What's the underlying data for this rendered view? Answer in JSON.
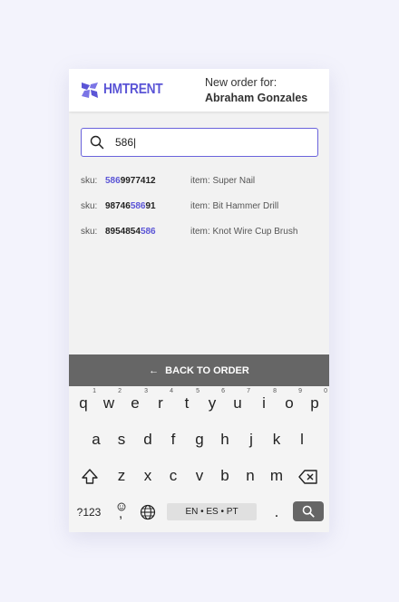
{
  "header": {
    "brand": "HMTRENT",
    "order_label": "New order for:",
    "customer_name": "Abraham Gonzales"
  },
  "search": {
    "value": "586|"
  },
  "results": [
    {
      "sku_label": "sku:",
      "sku_pre": "",
      "sku_match": "586",
      "sku_post": "9977412",
      "item": "item: Super Nail"
    },
    {
      "sku_label": "sku:",
      "sku_pre": "98746",
      "sku_match": "586",
      "sku_post": "91",
      "item": "item: Bit Hammer Drill"
    },
    {
      "sku_label": "sku:",
      "sku_pre": "8954854",
      "sku_match": "586",
      "sku_post": "",
      "item": "item: Knot Wire Cup Brush"
    }
  ],
  "back_button": {
    "label": "BACK TO ORDER"
  },
  "keyboard": {
    "row1": [
      {
        "key": "q",
        "hint": "1"
      },
      {
        "key": "w",
        "hint": "2"
      },
      {
        "key": "e",
        "hint": "3"
      },
      {
        "key": "r",
        "hint": "4"
      },
      {
        "key": "t",
        "hint": "5"
      },
      {
        "key": "y",
        "hint": "6"
      },
      {
        "key": "u",
        "hint": "7"
      },
      {
        "key": "i",
        "hint": "8"
      },
      {
        "key": "o",
        "hint": "9"
      },
      {
        "key": "p",
        "hint": "0"
      }
    ],
    "row2": [
      "a",
      "s",
      "d",
      "f",
      "g",
      "h",
      "j",
      "k",
      "l"
    ],
    "row3": [
      "z",
      "x",
      "c",
      "v",
      "b",
      "n",
      "m"
    ],
    "symbols_label": "?123",
    "comma_label": ",",
    "language_label": "EN • ES • PT",
    "period_label": "."
  },
  "colors": {
    "accent": "#5b55d6",
    "dark_bar": "#666666"
  }
}
